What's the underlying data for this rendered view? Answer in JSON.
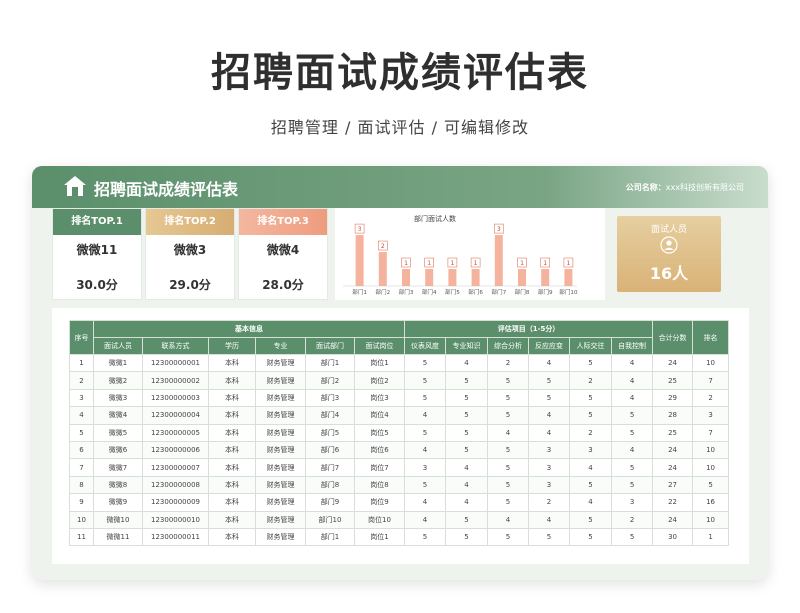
{
  "page": {
    "title": "招聘面试成绩评估表",
    "subtitle": "招聘管理 /  面试评估  /  可编辑修改"
  },
  "banner": {
    "title": "招聘面试成绩评估表",
    "company_label": "公司名称：",
    "company_value": "xxx科技创新有限公司"
  },
  "ranks": [
    {
      "label": "排名TOP.1",
      "name": "微微11",
      "score": "30.0分",
      "color": "#5b8f6c"
    },
    {
      "label": "排名TOP.2",
      "name": "微微3",
      "score": "29.0分",
      "color": "#dcb67e"
    },
    {
      "label": "排名TOP.3",
      "name": "微微4",
      "score": "28.0分",
      "color": "#f0a58a"
    }
  ],
  "chart_data": {
    "type": "bar",
    "title": "部门面试人数",
    "categories": [
      "部门1",
      "部门2",
      "部门3",
      "部门4",
      "部门5",
      "部门6",
      "部门7",
      "部门8",
      "部门9",
      "部门10"
    ],
    "values": [
      3,
      2,
      1,
      1,
      1,
      1,
      3,
      1,
      1,
      1
    ],
    "ylim": [
      0,
      3.3
    ],
    "bar_color": "#f3a58b"
  },
  "stat": {
    "label": "面试人员",
    "value": "16人",
    "icon": "user-circle-icon"
  },
  "table": {
    "groups": {
      "index": "序号",
      "basic": "基本信息",
      "eval": "评估项目（1-5分）",
      "total": "合计分数",
      "rank": "排名"
    },
    "columns": [
      "面试人员",
      "联系方式",
      "学历",
      "专业",
      "面试部门",
      "面试岗位",
      "仪表风度",
      "专业知识",
      "综合分析",
      "反应应变",
      "人际交往",
      "自我控制"
    ],
    "rows": [
      [
        "1",
        "微微1",
        "12300000001",
        "本科",
        "财务管理",
        "部门1",
        "岗位1",
        "5",
        "4",
        "2",
        "4",
        "5",
        "4",
        "24",
        "10"
      ],
      [
        "2",
        "微微2",
        "12300000002",
        "本科",
        "财务管理",
        "部门2",
        "岗位2",
        "5",
        "5",
        "5",
        "5",
        "2",
        "4",
        "25",
        "7"
      ],
      [
        "3",
        "微微3",
        "12300000003",
        "本科",
        "财务管理",
        "部门3",
        "岗位3",
        "5",
        "5",
        "5",
        "5",
        "5",
        "4",
        "29",
        "2"
      ],
      [
        "4",
        "微微4",
        "12300000004",
        "本科",
        "财务管理",
        "部门4",
        "岗位4",
        "4",
        "5",
        "5",
        "4",
        "5",
        "5",
        "28",
        "3"
      ],
      [
        "5",
        "微微5",
        "12300000005",
        "本科",
        "财务管理",
        "部门5",
        "岗位5",
        "5",
        "5",
        "4",
        "4",
        "2",
        "5",
        "25",
        "7"
      ],
      [
        "6",
        "微微6",
        "12300000006",
        "本科",
        "财务管理",
        "部门6",
        "岗位6",
        "4",
        "5",
        "5",
        "3",
        "3",
        "4",
        "24",
        "10"
      ],
      [
        "7",
        "微微7",
        "12300000007",
        "本科",
        "财务管理",
        "部门7",
        "岗位7",
        "3",
        "4",
        "5",
        "3",
        "4",
        "5",
        "24",
        "10"
      ],
      [
        "8",
        "微微8",
        "12300000008",
        "本科",
        "财务管理",
        "部门8",
        "岗位8",
        "5",
        "4",
        "5",
        "3",
        "5",
        "5",
        "27",
        "5"
      ],
      [
        "9",
        "微微9",
        "12300000009",
        "本科",
        "财务管理",
        "部门9",
        "岗位9",
        "4",
        "4",
        "5",
        "2",
        "4",
        "3",
        "22",
        "16"
      ],
      [
        "10",
        "微微10",
        "12300000010",
        "本科",
        "财务管理",
        "部门10",
        "岗位10",
        "4",
        "5",
        "4",
        "4",
        "5",
        "2",
        "24",
        "10"
      ],
      [
        "11",
        "微微11",
        "12300000011",
        "本科",
        "财务管理",
        "部门1",
        "岗位1",
        "5",
        "5",
        "5",
        "5",
        "5",
        "5",
        "30",
        "1"
      ]
    ]
  }
}
